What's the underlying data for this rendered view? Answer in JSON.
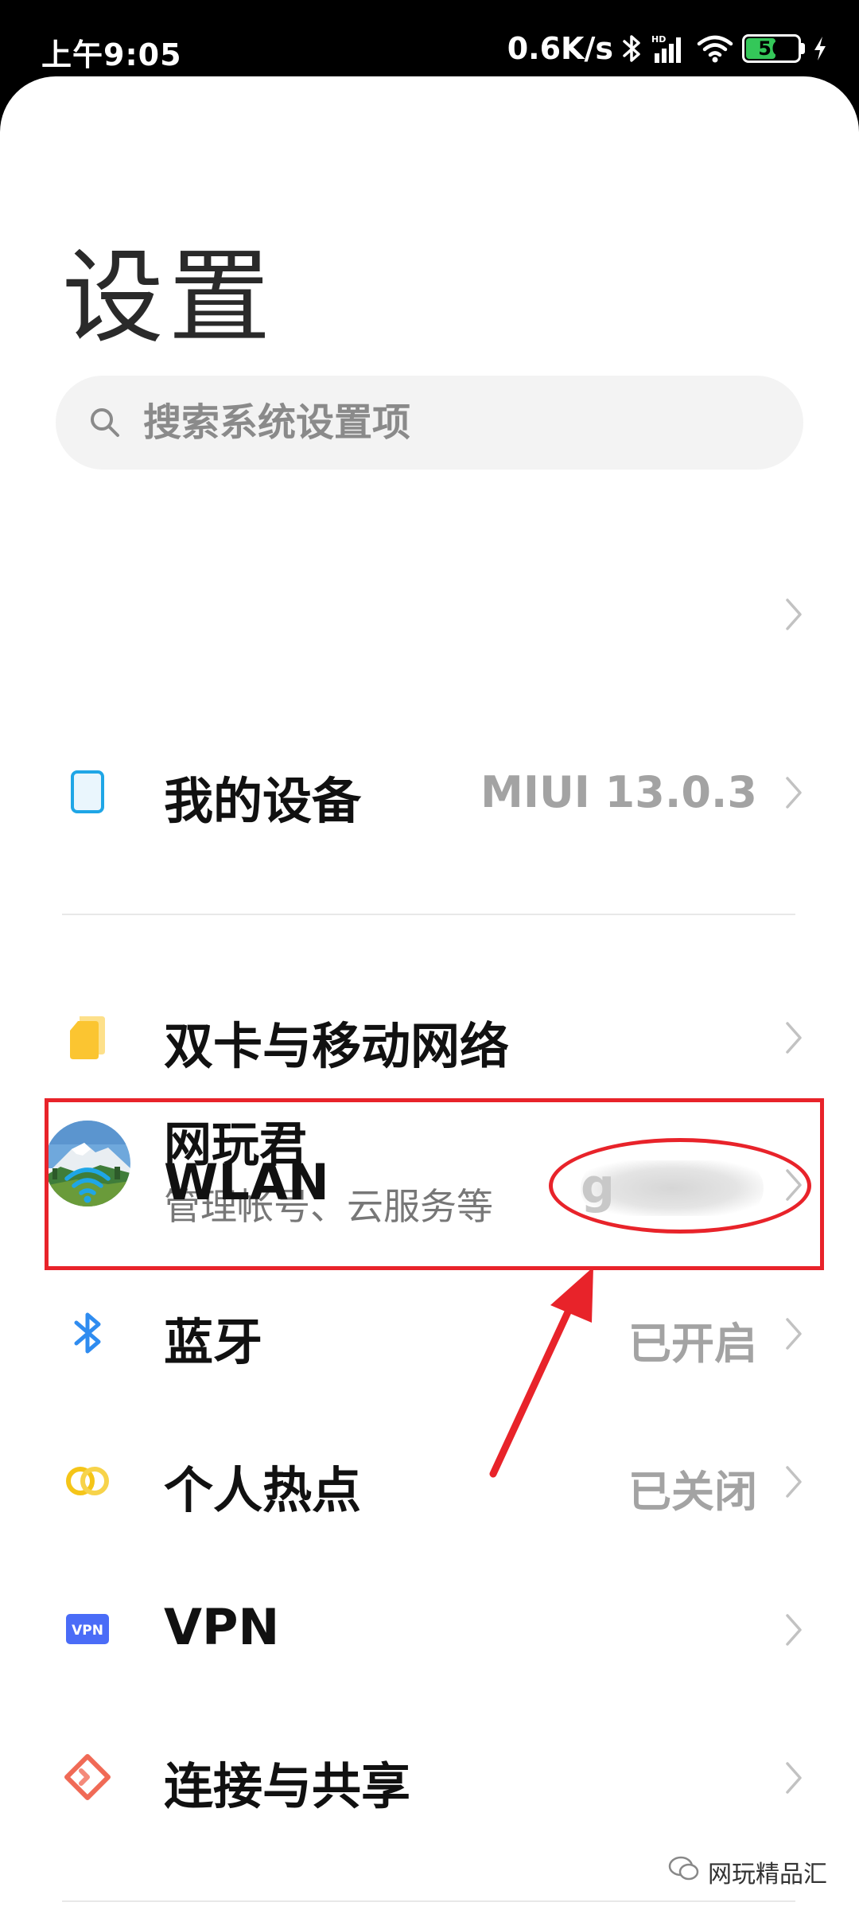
{
  "status_bar": {
    "time": "上午9:05",
    "network_speed": "0.6K/s",
    "battery_level": "56",
    "icons": [
      "bluetooth-icon",
      "signal-hd-icon",
      "wifi-icon",
      "battery-icon",
      "charging-icon"
    ]
  },
  "header": {
    "title": "设置"
  },
  "search": {
    "placeholder": "搜索系统设置项"
  },
  "account": {
    "name": "网玩君",
    "subtitle": "管理帐号、云服务等"
  },
  "settings": {
    "device": {
      "label": "我的设备",
      "value": "MIUI 13.0.3",
      "icon": "tablet-icon"
    },
    "sim": {
      "label": "双卡与移动网络",
      "value": "",
      "icon": "sim-card-icon"
    },
    "wlan": {
      "label": "WLAN",
      "value": "g",
      "icon": "wifi-icon"
    },
    "bluetooth": {
      "label": "蓝牙",
      "value": "已开启",
      "icon": "bluetooth-icon"
    },
    "hotspot": {
      "label": "个人热点",
      "value": "已关闭",
      "icon": "hotspot-icon"
    },
    "vpn": {
      "label": "VPN",
      "value": "",
      "icon": "vpn-icon",
      "badge": "VPN"
    },
    "connection": {
      "label": "连接与共享",
      "value": "",
      "icon": "connection-share-icon"
    }
  },
  "watermark": {
    "text": "网玩精品汇"
  },
  "colors": {
    "annotation_red": "#e8232a",
    "value_gray": "#a3a3a3",
    "wifi_blue": "#1fa6e6",
    "bluetooth_blue": "#2f8cf0",
    "sim_yellow": "#fbc531",
    "hotspot_yellow": "#f5c518",
    "vpn_blue": "#4a6cf7",
    "connection_red": "#f06a56"
  }
}
